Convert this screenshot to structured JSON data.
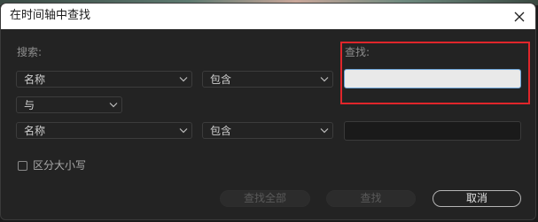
{
  "dialog": {
    "title": "在时间轴中查找",
    "search_label": "搜索:",
    "find_label": "查找:",
    "row1": {
      "field": "名称",
      "operator": "包含",
      "value": ""
    },
    "conjunction": "与",
    "row2": {
      "field": "名称",
      "operator": "包含",
      "value": ""
    },
    "case_sensitive": {
      "label": "区分大小写",
      "checked": false
    },
    "buttons": {
      "find_all": "查找全部",
      "find": "查找",
      "cancel": "取消"
    }
  },
  "colors": {
    "highlight": "#e0262b",
    "dialog_bg": "#232323",
    "titlebar_bg": "#ffffff"
  }
}
